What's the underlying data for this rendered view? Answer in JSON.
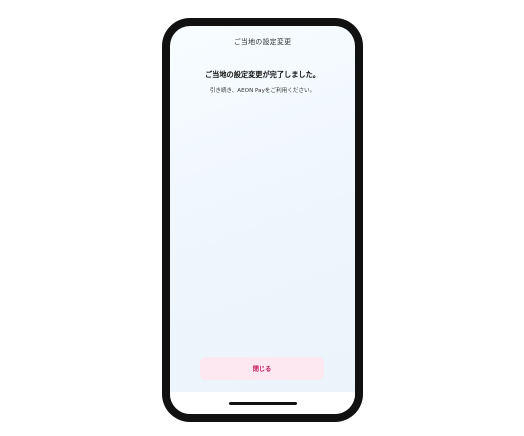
{
  "header": {
    "title": "ご当地の設定変更"
  },
  "message": {
    "title": "ご当地の設定変更が完了しました。",
    "subtitle": "引き続き、AEON Payをご利用ください。"
  },
  "actions": {
    "close_label": "閉じる"
  },
  "colors": {
    "accent": "#c2185b",
    "button_bg": "#fde8f1",
    "frame": "#111111"
  }
}
